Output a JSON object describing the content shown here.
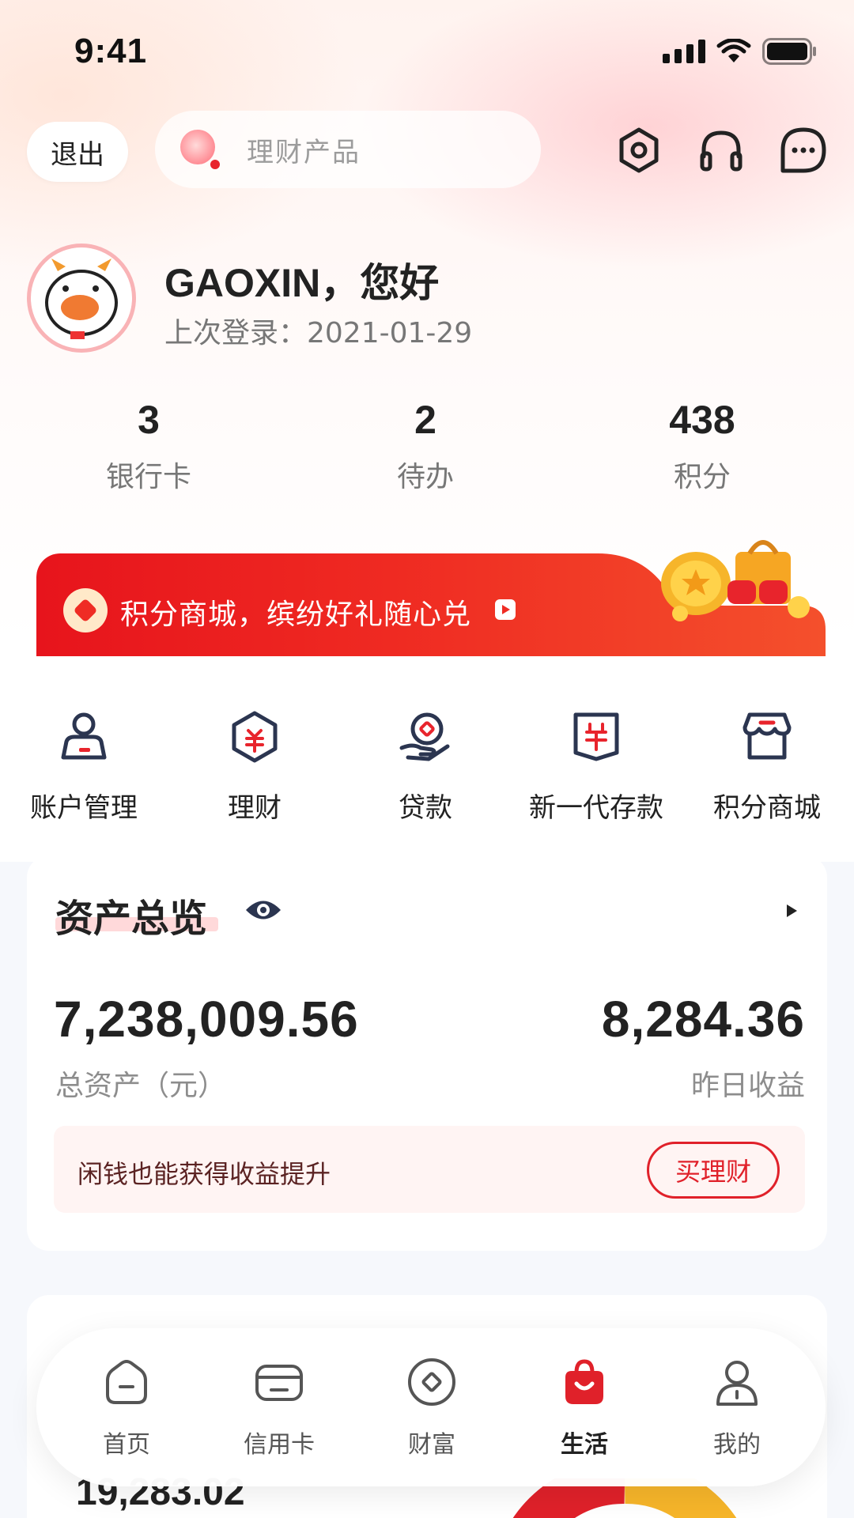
{
  "status_bar": {
    "time": "9:41"
  },
  "header": {
    "logout_label": "退出",
    "search_placeholder": "理财产品",
    "icons": [
      "settings-hex-icon",
      "headset-icon",
      "message-icon"
    ]
  },
  "profile": {
    "greeting": "GAOXIN，您好",
    "last_login": "上次登录：2021-01-29"
  },
  "stats": [
    {
      "value": "3",
      "label": "银行卡"
    },
    {
      "value": "2",
      "label": "待办"
    },
    {
      "value": "438",
      "label": "积分"
    }
  ],
  "promo": {
    "text": "积分商城，缤纷好礼随心兑"
  },
  "quick_menu": [
    {
      "label": "账户管理",
      "icon": "account-icon"
    },
    {
      "label": "理财",
      "icon": "finance-icon"
    },
    {
      "label": "贷款",
      "icon": "loan-icon"
    },
    {
      "label": "新一代存款",
      "icon": "deposit-icon"
    },
    {
      "label": "积分商城",
      "icon": "store-icon"
    }
  ],
  "assets": {
    "title": "资产总览",
    "total_value": "7,238,009.56",
    "total_label": "总资产（元）",
    "yesterday_value": "8,284.36",
    "yesterday_label": "昨日收益",
    "tip_text": "闲钱也能获得收益提升",
    "buy_label": "买理财"
  },
  "next_card": {
    "value": "19,283.02"
  },
  "colors": {
    "accent": "#e0212a",
    "navy": "#2b3550"
  },
  "tabbar": [
    {
      "label": "首页",
      "icon": "home-icon",
      "active": false
    },
    {
      "label": "信用卡",
      "icon": "credit-card-icon",
      "active": false
    },
    {
      "label": "财富",
      "icon": "wealth-icon",
      "active": false
    },
    {
      "label": "生活",
      "icon": "life-bag-icon",
      "active": true
    },
    {
      "label": "我的",
      "icon": "profile-icon",
      "active": false
    }
  ]
}
